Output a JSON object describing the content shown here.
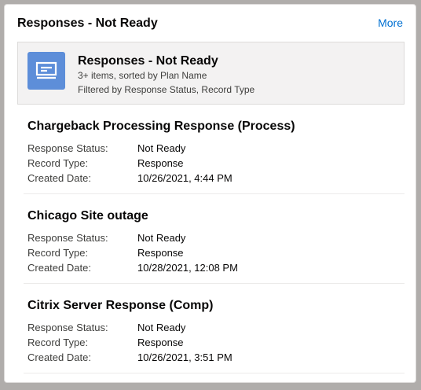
{
  "card": {
    "title": "Responses - Not Ready",
    "more_label": "More"
  },
  "summary": {
    "icon": "list-view-icon",
    "icon_color": "#5d8ed9",
    "title": "Responses - Not Ready",
    "line1": "3+ items, sorted by Plan Name",
    "line2": "Filtered by Response Status, Record Type"
  },
  "field_labels": {
    "status": "Response Status:",
    "record_type": "Record Type:",
    "created_date": "Created Date:"
  },
  "records": [
    {
      "title": "Chargeback Processing Response (Process)",
      "status": "Not Ready",
      "record_type": "Response",
      "created_date": "10/26/2021, 4:44 PM"
    },
    {
      "title": "Chicago Site outage",
      "status": "Not Ready",
      "record_type": "Response",
      "created_date": "10/28/2021, 12:08 PM"
    },
    {
      "title": "Citrix Server Response (Comp)",
      "status": "Not Ready",
      "record_type": "Response",
      "created_date": "10/26/2021, 3:51 PM"
    }
  ],
  "colors": {
    "link": "#0070d2",
    "summary_background": "#f3f2f2"
  }
}
